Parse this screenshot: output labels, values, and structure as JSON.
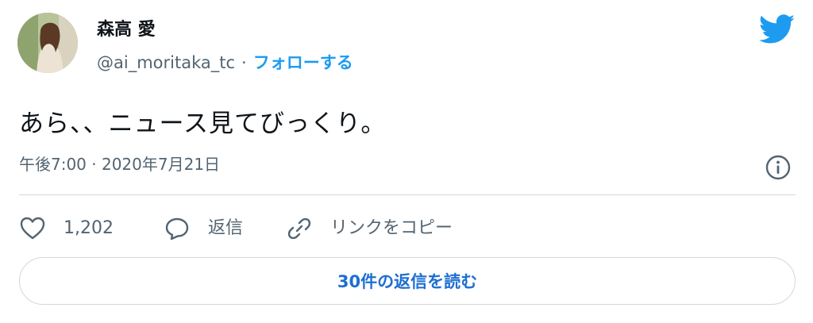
{
  "author": {
    "display_name": "森高 愛",
    "handle": "@ai_moritaka_tc",
    "separator": "·",
    "follow_label": "フォローする"
  },
  "tweet": {
    "text": "あら、、ニュース見てびっくり。",
    "timestamp": "午後7:00 · 2020年7月21日"
  },
  "actions": {
    "like_count": "1,202",
    "reply_label": "返信",
    "copy_link_label": "リンクをコピー"
  },
  "footer": {
    "read_replies_label": "30件の返信を読む"
  },
  "icons": [
    "twitter-bird-icon",
    "info-icon",
    "heart-icon",
    "reply-bubble-icon",
    "link-icon"
  ],
  "colors": {
    "accent": "#1d9bf0",
    "link_button": "#1d6fd1",
    "secondary_text": "#536471",
    "border": "#cfd9de"
  }
}
